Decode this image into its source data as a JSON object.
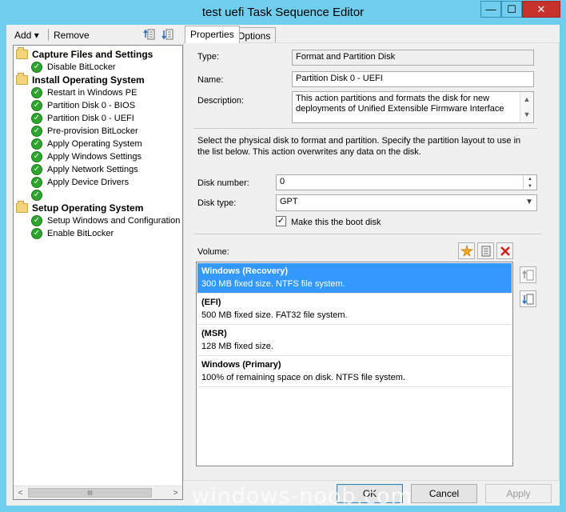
{
  "window": {
    "title": "test uefi Task Sequence Editor",
    "min_glyph": "—",
    "max_glyph": "☐",
    "close_glyph": "✕",
    "accent": "#6fcdee",
    "close_color": "#c7312b"
  },
  "toolbar": {
    "add_label": "Add",
    "add_arrow": "▾",
    "remove_label": "Remove"
  },
  "tree": {
    "groups": [
      {
        "label": "Capture Files and Settings",
        "items": [
          "Disable BitLocker"
        ]
      },
      {
        "label": "Install Operating System",
        "items": [
          "Restart in Windows PE",
          "Partition Disk 0 - BIOS",
          "Partition Disk 0 - UEFI",
          "Pre-provision BitLocker",
          "Apply Operating System",
          "Apply Windows Settings",
          "Apply Network Settings",
          "Apply Device Drivers"
        ]
      },
      {
        "label": "Setup Operating System",
        "items": [
          "Setup Windows and Configuration",
          "Enable BitLocker"
        ]
      }
    ],
    "scroll_left": "<",
    "scroll_right": ">",
    "scroll_thumb": "III",
    "check_glyph": "✓"
  },
  "tabs": [
    {
      "label": "Properties",
      "active": true
    },
    {
      "label": "Options",
      "active": false
    }
  ],
  "properties": {
    "type_label": "Type:",
    "type_value": "Format and Partition Disk",
    "name_label": "Name:",
    "name_value": "Partition Disk 0 - UEFI",
    "description_label": "Description:",
    "description_value": "This action partitions and formats the disk for new deployments of Unified Extensible Firmware Interface",
    "instructions": "Select the physical disk to format and partition. Specify the partition layout to use in the list below. This action overwrites any data on the disk.",
    "disk_number_label": "Disk number:",
    "disk_number_value": "0",
    "disk_type_label": "Disk type:",
    "disk_type_value": "GPT",
    "boot_disk_label": "Make this the boot disk",
    "boot_disk_checked": "✓",
    "volume_label": "Volume:",
    "scroll_up": "▲",
    "scroll_down": "▼",
    "select_arrow": "▼"
  },
  "volumes": [
    {
      "name": "Windows (Recovery)",
      "desc": "300 MB fixed size. NTFS file system.",
      "selected": true
    },
    {
      "name": "(EFI)",
      "desc": "500 MB fixed size. FAT32 file system.",
      "selected": false
    },
    {
      "name": "(MSR)",
      "desc": "128 MB fixed size.",
      "selected": false
    },
    {
      "name": "Windows (Primary)",
      "desc": "100% of remaining space on disk. NTFS file system.",
      "selected": false
    }
  ],
  "buttons": {
    "ok": "OK",
    "cancel": "Cancel",
    "apply": "Apply"
  },
  "watermark": "windows-noob.com"
}
